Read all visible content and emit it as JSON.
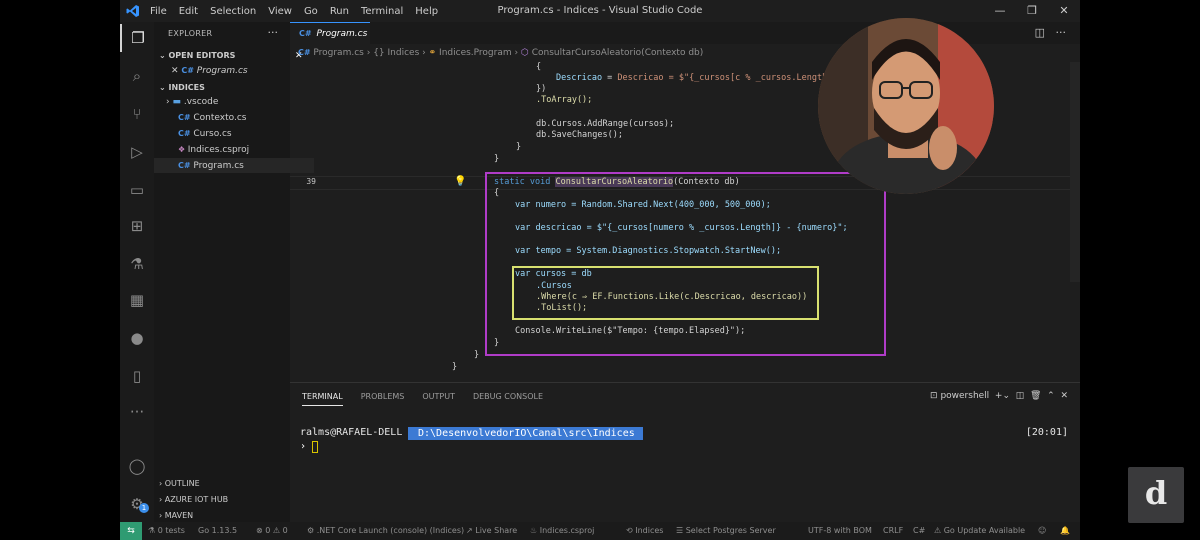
{
  "titlebar": {
    "menu": [
      "File",
      "Edit",
      "Selection",
      "View",
      "Go",
      "Run",
      "Terminal",
      "Help"
    ],
    "window_title": "Program.cs - Indices - Visual Studio Code",
    "minimize": "—",
    "maximize": "❐",
    "close": "✕"
  },
  "sidebar": {
    "header": "EXPLORER",
    "more": "···",
    "open_editors_label": "OPEN EDITORS",
    "open_editor_file": "Program.cs",
    "project_label": "INDICES",
    "tree": [
      {
        "type": "folder",
        "name": ".vscode"
      },
      {
        "type": "cs",
        "name": "Contexto.cs"
      },
      {
        "type": "cs",
        "name": "Curso.cs"
      },
      {
        "type": "csproj",
        "name": "Indices.csproj"
      },
      {
        "type": "cs",
        "name": "Program.cs"
      }
    ],
    "bottom_sections": [
      "OUTLINE",
      "AZURE IOT HUB",
      "MAVEN"
    ]
  },
  "tabs": [
    {
      "label": "Program.cs",
      "lang": "C#"
    }
  ],
  "breadcrumb": {
    "file": "Program.cs",
    "namespace": "Indices",
    "class": "Indices.Program",
    "method": "ConsultarCursoAleatorio(Contexto db)",
    "sep": "›"
  },
  "editor": {
    "current_line_number": "39",
    "code_lines": {
      "l1": "{",
      "l2a": "Descricao = $\"{_cursos[c % _cursos.Length]} - {c}\"",
      "l3": "})",
      "l4": ".ToArray();",
      "l5": "db.Cursos.AddRange(cursos);",
      "l6": "db.SaveChanges();",
      "l7": "}",
      "l8": "}",
      "l9_kw": "static",
      "l9_void": "void",
      "l9_name_a": "Consult",
      "l9_name_b": "arCursoAleatorio",
      "l9_rest": "(Contexto db)",
      "l10": "{",
      "l11": "var numero = Random.Shared.Next(400_000, 500_000);",
      "l12": "var descricao = $\"{_cursos[numero % _cursos.Length]} - {numero}\";",
      "l13": "var tempo = System.Diagnostics.Stopwatch.StartNew();",
      "l14": "var cursos = db",
      "l15": ".Cursos",
      "l16": ".Where(c ⇒ EF.Functions.Like(c.Descricao, descricao))",
      "l17": ".ToList();",
      "l18": "Console.WriteLine($\"Tempo: {tempo.Elapsed}\");",
      "l19": "}",
      "l20": "}",
      "l21": "}"
    }
  },
  "panel": {
    "tabs": [
      "TERMINAL",
      "PROBLEMS",
      "OUTPUT",
      "DEBUG CONSOLE"
    ],
    "active_tab": "TERMINAL",
    "shell": "powershell",
    "terminal": {
      "user": "ralms@RAFAEL-DELL",
      "path": "D:\\DesenvolvedorIO\\Canal\\src\\Indices",
      "time": "[20:01]",
      "caret": "›"
    }
  },
  "statusbar": {
    "remote": "⇆",
    "tests": "0 tests",
    "go_version": "Go 1.13.5",
    "problems": "⊗ 0 ⚠ 0",
    "launch": ".NET Core Launch (console) (Indices)",
    "live_share": "Live Share",
    "csproj": "Indices.csproj",
    "project": "Indices",
    "postgres": "Select Postgres Server",
    "encoding": "UTF-8 with BOM",
    "eol": "CRLF",
    "language": "C#",
    "go_update": "Go Update Available"
  },
  "activity_badge": "1",
  "logo_letter": "d",
  "colors": {
    "accent_blue": "#3794ff",
    "highlight_box_purple": "#b03cc8",
    "highlight_box_yellow": "#d8e070",
    "status_remote_green": "#2f9b72",
    "terminal_path_bg": "#3c7ad4"
  }
}
